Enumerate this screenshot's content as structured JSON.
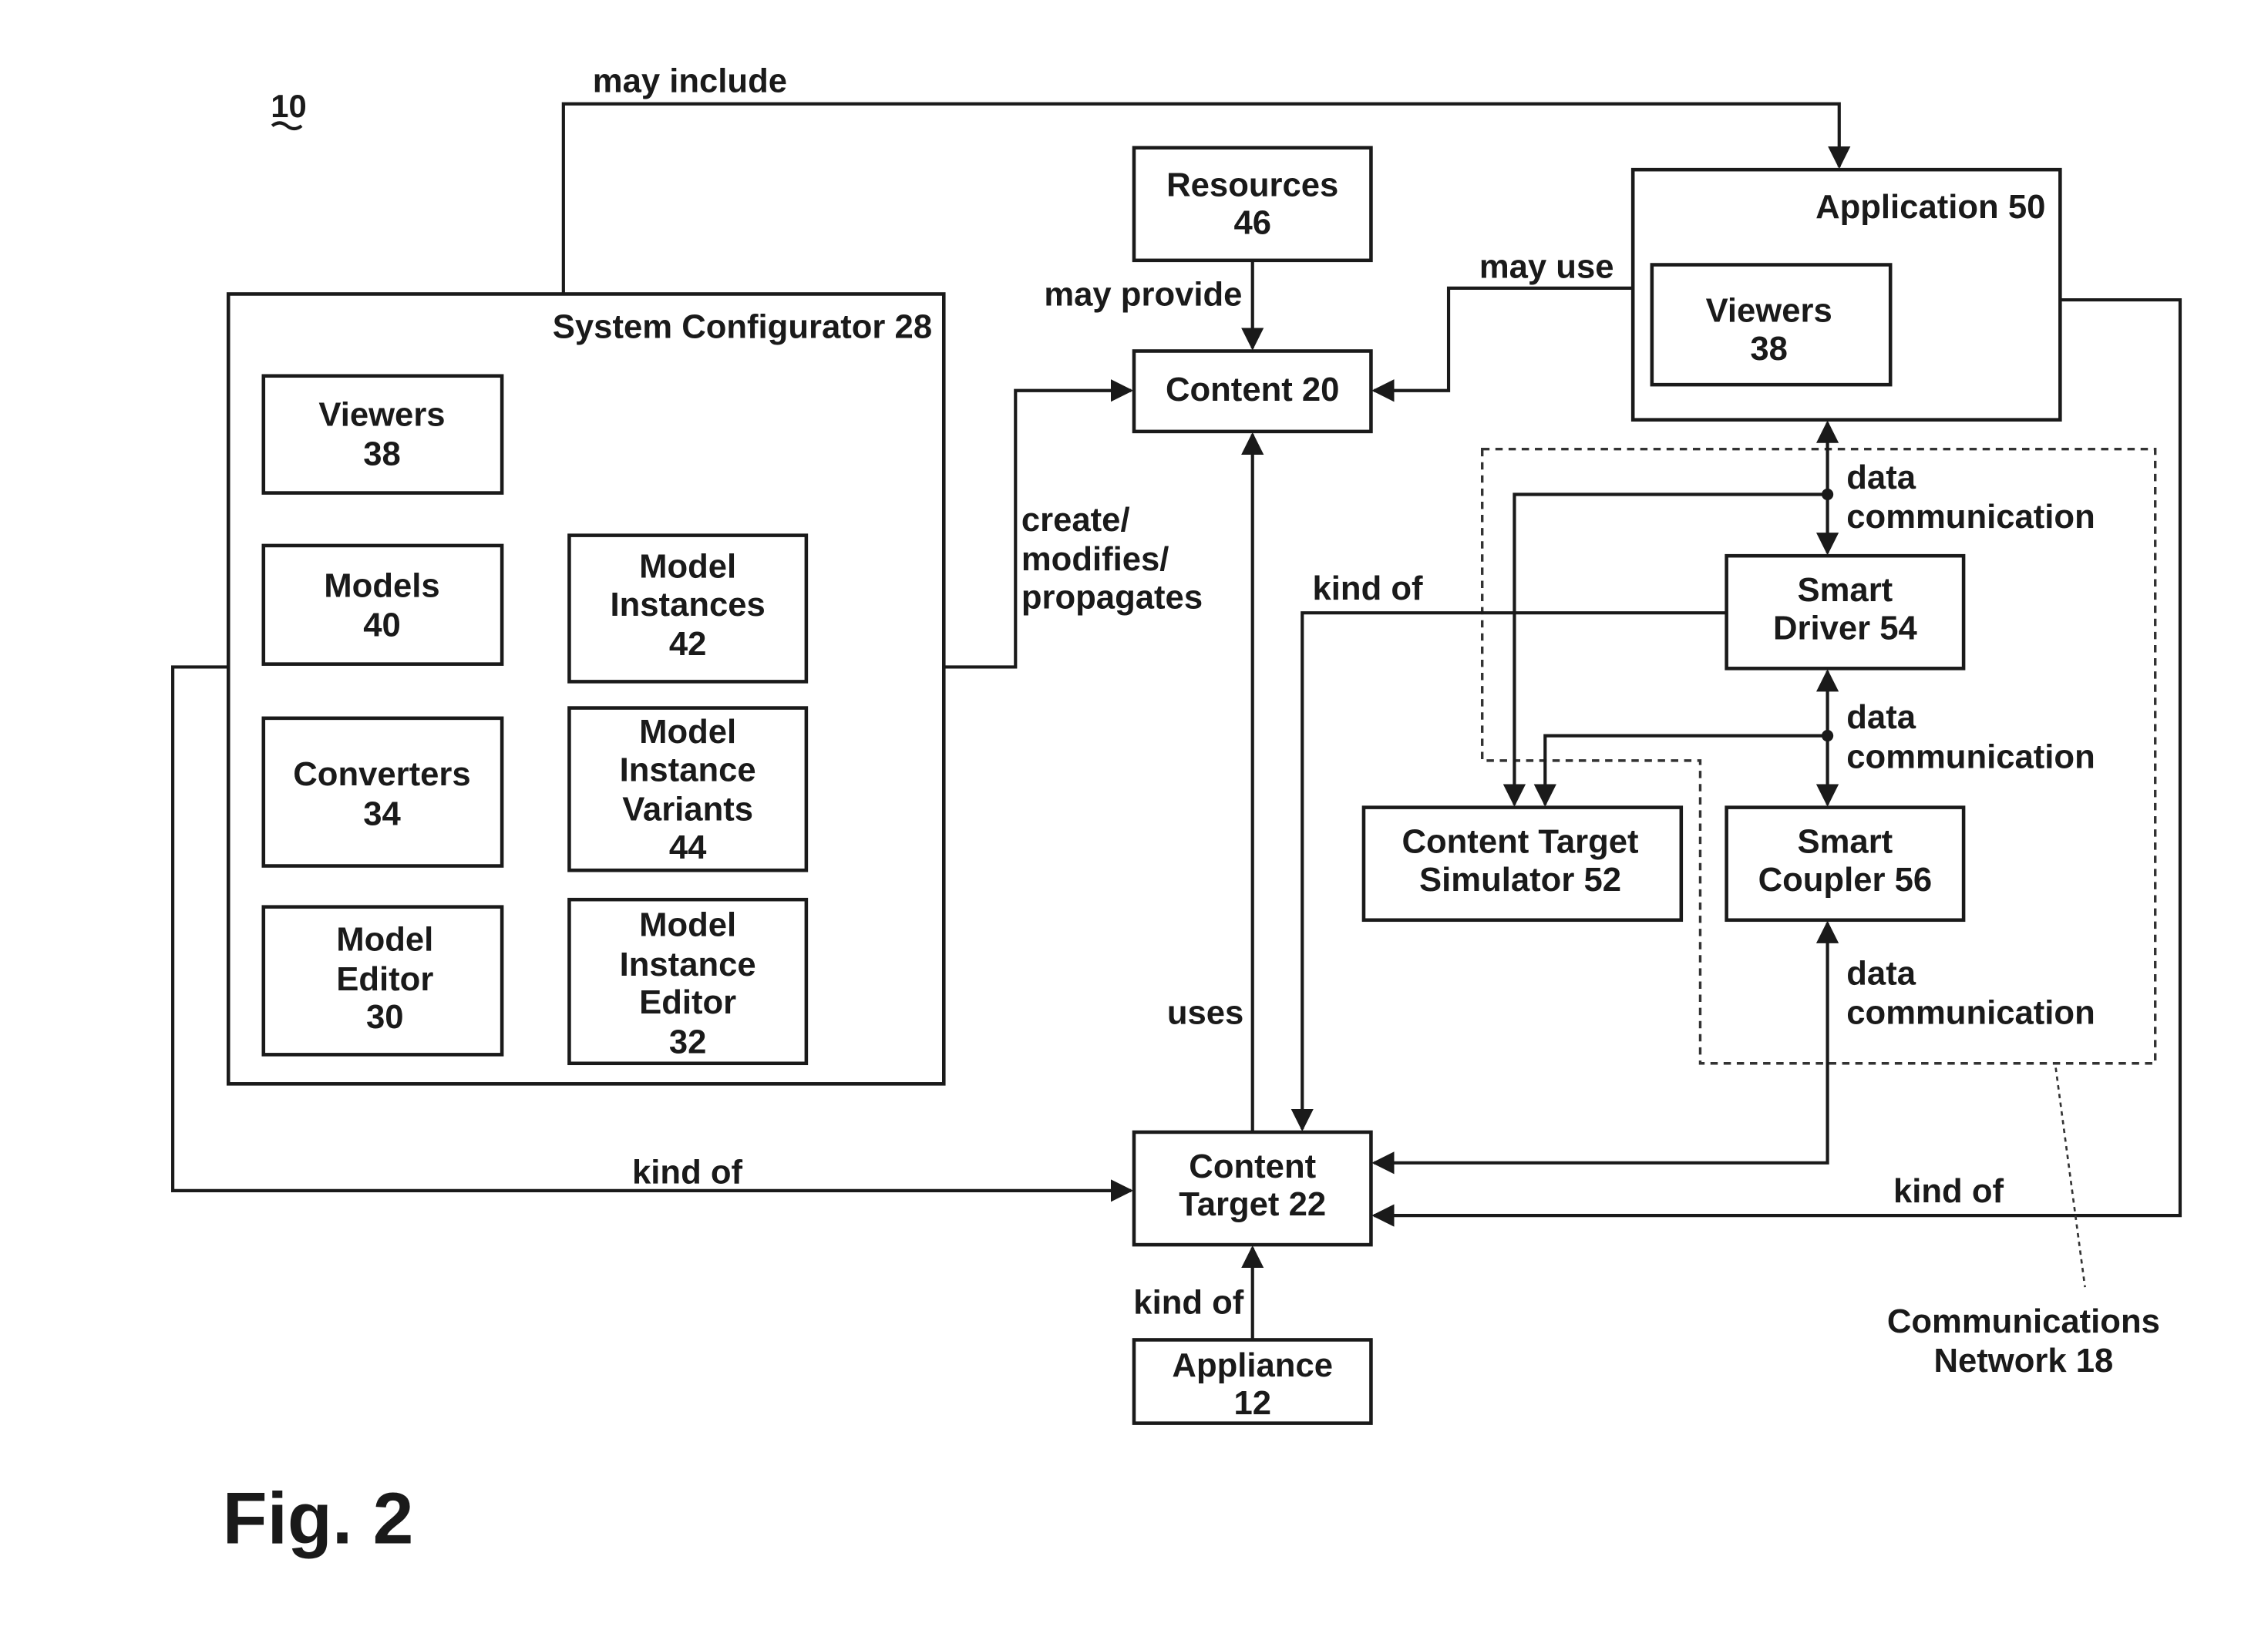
{
  "figure": {
    "label": "Fig. 2",
    "reference": "10"
  },
  "boxes": {
    "system_configurator": {
      "title": "System Configurator  28"
    },
    "sc_viewers": {
      "lines": [
        "Viewers",
        "38"
      ]
    },
    "sc_models": {
      "lines": [
        "Models",
        "40"
      ]
    },
    "sc_model_instances": {
      "lines": [
        "Model",
        "Instances",
        "42"
      ]
    },
    "sc_converters": {
      "lines": [
        "Converters",
        "34"
      ]
    },
    "sc_model_instance_variants": {
      "lines": [
        "Model",
        "Instance",
        "Variants",
        "44"
      ]
    },
    "sc_model_editor": {
      "lines": [
        "Model",
        "Editor",
        "30"
      ]
    },
    "sc_model_instance_editor": {
      "lines": [
        "Model",
        "Instance",
        "Editor",
        "32"
      ]
    },
    "resources": {
      "lines": [
        "Resources",
        "46"
      ]
    },
    "content": {
      "lines": [
        "Content  20"
      ]
    },
    "application": {
      "title": "Application  50"
    },
    "app_viewers": {
      "lines": [
        "Viewers",
        "38"
      ]
    },
    "smart_driver": {
      "lines": [
        "Smart",
        "Driver 54"
      ]
    },
    "content_target_simulator": {
      "lines": [
        "Content Target",
        "Simulator 52"
      ]
    },
    "smart_coupler": {
      "lines": [
        "Smart",
        "Coupler 56"
      ]
    },
    "content_target": {
      "lines": [
        "Content",
        "Target 22"
      ]
    },
    "appliance": {
      "lines": [
        "Appliance",
        "12"
      ]
    }
  },
  "edges": {
    "may_include": "may include",
    "may_provide": "may provide",
    "may_use": "may use",
    "create_modifies_propagates": [
      "create/",
      "modifies/",
      "propagates"
    ],
    "kind_of_driver": "kind of",
    "data_comm_1": [
      "data",
      "communication"
    ],
    "data_comm_2": [
      "data",
      "communication"
    ],
    "data_comm_3": [
      "data",
      "communication"
    ],
    "uses": "uses",
    "kind_of_configurator": "kind of",
    "kind_of_application": "kind of",
    "kind_of_appliance": "kind of"
  },
  "network": {
    "lines": [
      "Communications",
      "Network 18"
    ]
  }
}
